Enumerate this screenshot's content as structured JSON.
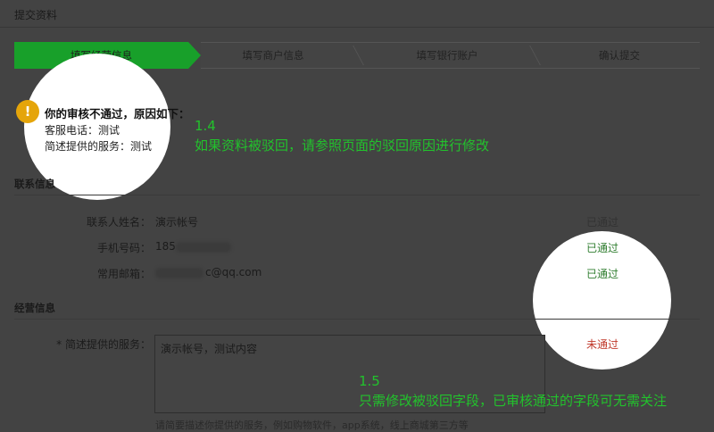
{
  "page": {
    "title": "提交资料"
  },
  "steps": [
    {
      "label": "填写经营信息",
      "active": true
    },
    {
      "label": "填写商户信息",
      "active": false
    },
    {
      "label": "填写银行账户",
      "active": false
    },
    {
      "label": "确认提交",
      "active": false
    }
  ],
  "notice": {
    "icon": "!",
    "title": "你的审核不通过，原因如下：",
    "lines": [
      "客服电话：测试",
      "简述提供的服务：测试"
    ]
  },
  "annotations": {
    "a1_num": "1.4",
    "a1_text": "如果资料被驳回，请参照页面的驳回原因进行修改",
    "a2_num": "1.5",
    "a2_text": "只需修改被驳回字段，已审核通过的字段可无需关注"
  },
  "contact": {
    "section_title": "联系信息",
    "rows": [
      {
        "label": "联系人姓名：",
        "value": "演示帐号",
        "status": "已通过"
      },
      {
        "label": "手机号码：",
        "value": "185",
        "status": "已通过"
      },
      {
        "label": "常用邮箱：",
        "value": "c@qq.com",
        "status": "已通过"
      }
    ]
  },
  "business": {
    "section_title": "经营信息",
    "service_label": "* 简述提供的服务：",
    "service_value": "演示帐号，测试内容",
    "service_status": "未通过",
    "hint": "请简要描述你提供的服务，例如购物软件，app系统，线上商城第三方等"
  },
  "colors": {
    "active_step": "#18a02a",
    "annotation": "#22c22c",
    "pass": "#2f7d2f",
    "fail": "#c0392b",
    "notice_icon": "#e5a50a"
  }
}
